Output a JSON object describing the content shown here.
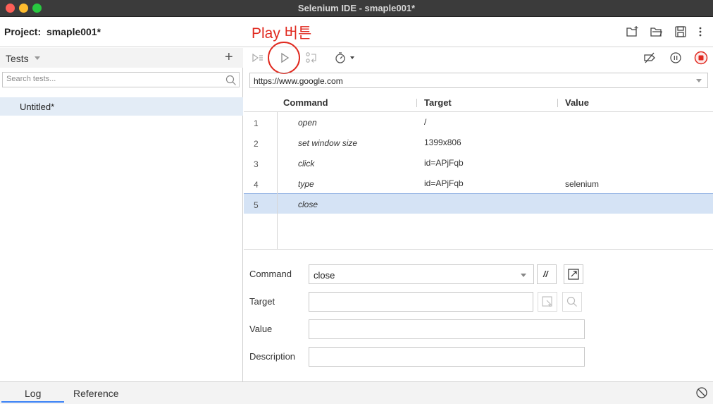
{
  "window": {
    "title": "Selenium IDE - smaple001*",
    "colors": {
      "titlebar": "#3b3b3b",
      "close": "#fe5f57",
      "minimize": "#febc2e",
      "zoom": "#28c840"
    }
  },
  "project": {
    "label": "Project:",
    "name": "smaple001*",
    "icons": [
      "new-folder-icon",
      "open-folder-icon",
      "save-icon",
      "more-options-icon"
    ]
  },
  "annotation": {
    "text": "Play 버튼",
    "color": "#e0291f"
  },
  "tests_panel": {
    "title": "Tests",
    "search_placeholder": "Search tests...",
    "items": [
      {
        "label": "Untitled*",
        "selected": true
      }
    ]
  },
  "toolbar": {
    "icons": [
      "run-all-tests-icon",
      "run-current-test-icon",
      "step-over-icon",
      "test-execution-speed-icon",
      "disable-breakpoints-icon",
      "pause-on-exceptions-icon",
      "record-stop-icon"
    ],
    "record_color": "#e0291f"
  },
  "url_bar": {
    "value": "https://www.google.com"
  },
  "table": {
    "columns": [
      "Command",
      "Target",
      "Value"
    ],
    "rows": [
      {
        "index": "1",
        "command": "open",
        "target": "/",
        "value": ""
      },
      {
        "index": "2",
        "command": "set window size",
        "target": "1399x806",
        "value": ""
      },
      {
        "index": "3",
        "command": "click",
        "target": "id=APjFqb",
        "value": ""
      },
      {
        "index": "4",
        "command": "type",
        "target": "id=APjFqb",
        "value": "selenium"
      },
      {
        "index": "5",
        "command": "close",
        "target": "",
        "value": ""
      }
    ],
    "selected_row": 5
  },
  "editor": {
    "command_label": "Command",
    "command_value": "close",
    "comment_button": "//",
    "target_label": "Target",
    "target_value": "",
    "value_label": "Value",
    "value_value": "",
    "description_label": "Description",
    "description_value": ""
  },
  "bottom": {
    "tabs": [
      {
        "label": "Log",
        "active": true
      },
      {
        "label": "Reference",
        "active": false
      }
    ],
    "icon": "clear-log-icon"
  }
}
